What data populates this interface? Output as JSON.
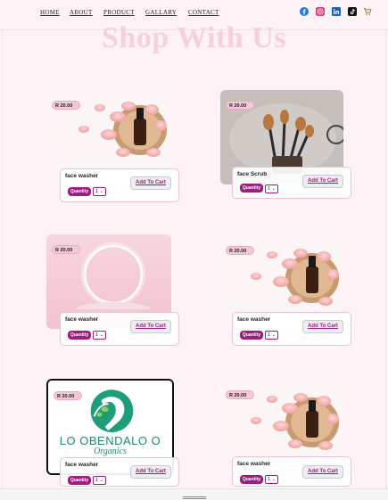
{
  "nav": {
    "items": [
      "HOME",
      "ABOUT",
      "PRODUCT",
      "GALLARY",
      "CONTACT"
    ],
    "socials": [
      "facebook-icon",
      "instagram-icon",
      "linkedin-icon",
      "tiktok-icon",
      "cart-icon"
    ]
  },
  "hero": {
    "title": "Shop With Us"
  },
  "products": [
    {
      "price": "R 20.00",
      "name": "face washer",
      "qty_label": "Quantity",
      "qty": "1",
      "cart_label": "Add To Cart",
      "image": "serum-bottle-rose-petals"
    },
    {
      "price": "R 20.00",
      "name": "face Scrub",
      "qty_label": "Quantity",
      "qty": "1",
      "cart_label": "Add To Cart",
      "image": "makeup-brushes"
    },
    {
      "price": "R 20.00",
      "name": "face washer",
      "qty_label": "Quantity",
      "qty": "1",
      "cart_label": "Add To Cart",
      "image": "pink-podium-ring"
    },
    {
      "price": "R 20.00",
      "name": "face washer",
      "qty_label": "Quantity",
      "qty": "1",
      "cart_label": "Add To Cart",
      "image": "serum-bottle-rose-petals"
    },
    {
      "price": "R 20.00",
      "name": "face washer",
      "qty_label": "Quantity",
      "qty": "1",
      "cart_label": "Add To Cart",
      "image": "obendalo-organics-logo"
    },
    {
      "price": "R 20.00",
      "name": "face washer",
      "qty_label": "Quantity",
      "qty": "1",
      "cart_label": "Add To Cart",
      "image": "serum-bottle-rose-petals"
    }
  ],
  "logo_text": {
    "line1": "LO OBENDALO O",
    "line2": "Organics"
  },
  "colors": {
    "accent": "#9b1f7f",
    "hero": "#f6d0dc",
    "price_badge": "#f4c8d8"
  }
}
